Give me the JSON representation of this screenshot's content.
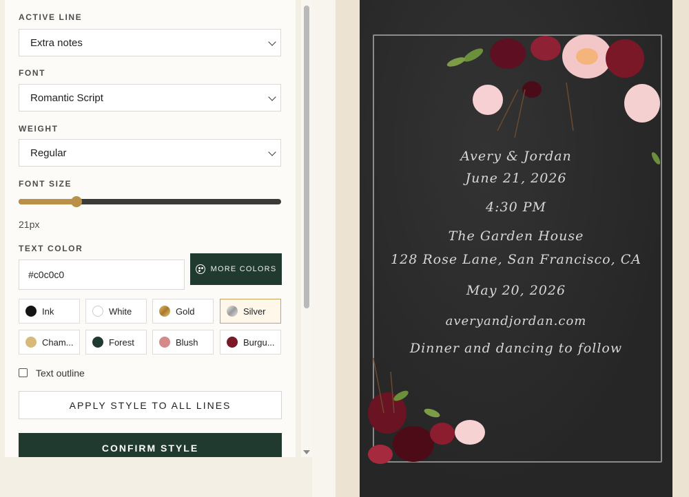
{
  "panel": {
    "active_line_label": "ACTIVE LINE",
    "active_line_value": "Extra notes",
    "font_label": "FONT",
    "font_value": "Romantic Script",
    "weight_label": "WEIGHT",
    "weight_value": "Regular",
    "font_size_label": "FONT SIZE",
    "font_size_readout": "21px",
    "font_size_fraction": 0.22,
    "text_color_label": "TEXT COLOR",
    "text_color_value": "#c0c0c0",
    "more_colors_label": "MORE COLORS",
    "swatches": [
      {
        "label": "Ink",
        "color": "#141414"
      },
      {
        "label": "White",
        "color": "#ffffff"
      },
      {
        "label": "Gold",
        "color": "#c79a3b"
      },
      {
        "label": "Silver",
        "color": "#c0c0c0"
      },
      {
        "label": "Cham...",
        "color": "#d8b97a"
      },
      {
        "label": "Forest",
        "color": "#213a30"
      },
      {
        "label": "Blush",
        "color": "#d4898a"
      },
      {
        "label": "Burgu...",
        "color": "#7a1a26"
      }
    ],
    "selected_swatch": "Silver",
    "text_outline_label": "Text outline",
    "apply_all_label": "APPLY STYLE TO ALL LINES",
    "confirm_label": "CONFIRM STYLE"
  },
  "card": {
    "names": "Avery & Jordan",
    "date": "June 21, 2026",
    "time": "4:30 PM",
    "venue": "The Garden House",
    "address": "128 Rose Lane, San Francisco, CA",
    "rsvp_date": "May 20, 2026",
    "website": "averyandjordan.com",
    "extra_notes": "Dinner and dancing to follow",
    "text_color": "#d8d8d8"
  }
}
